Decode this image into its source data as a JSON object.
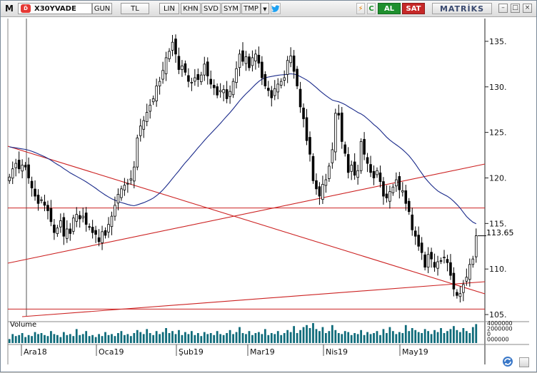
{
  "toolbar": {
    "logo": "M",
    "symbol_icon": "D̈",
    "symbol": "X30YVADE",
    "period": "GUN",
    "currency": "TL",
    "scale_buttons": [
      "LIN",
      "KHN",
      "SVD",
      "SYM",
      "TMP"
    ],
    "dropdown_icon": "▼",
    "twitter_icon": "twitter-bird",
    "flash_icon": "⚡",
    "refresh_icon": "C",
    "buy_label": "AL",
    "sell_label": "SAT",
    "brand": "MATRİKS",
    "window_buttons": [
      "–",
      "□",
      "×"
    ]
  },
  "chart": {
    "current_price_label": "113.65",
    "volume_label": "Volume",
    "volume_axis_labels": [
      "4000000",
      "2000000",
      "0",
      "000000"
    ]
  },
  "chart_data": {
    "type": "candlestick",
    "price_axis": {
      "ticks": [
        105,
        110,
        115,
        120,
        125,
        130,
        135
      ],
      "tick_labels": [
        "105.",
        "110.",
        "115.",
        "120.",
        "125.",
        "130.",
        "135."
      ],
      "range": [
        104.3,
        137.5
      ]
    },
    "time_axis_labels": [
      "Ara18",
      "Oca19",
      "Şub19",
      "Mar19",
      "Nis19",
      "May19"
    ],
    "current_price": 113.65,
    "horizontal_levels": [
      116.7,
      105.6
    ],
    "closes": [
      120.1,
      121.0,
      121.6,
      121.0,
      121.4,
      121.2,
      120.0,
      118.9,
      118.0,
      117.2,
      117.6,
      117.0,
      116.4,
      115.2,
      114.0,
      114.5,
      115.3,
      113.6,
      114.4,
      113.9,
      115.6,
      116.0,
      115.5,
      115.8,
      114.9,
      114.6,
      114.0,
      113.8,
      113.0,
      114.1,
      113.7,
      114.9,
      115.8,
      117.0,
      118.2,
      118.8,
      119.2,
      119.4,
      119.9,
      121.2,
      124.4,
      125.7,
      126.3,
      127.2,
      128.0,
      128.7,
      130.1,
      130.6,
      131.8,
      133.2,
      133.9,
      134.9,
      133.6,
      131.9,
      132.3,
      131.6,
      130.6,
      130.5,
      131.0,
      130.8,
      131.3,
      132.5,
      131.2,
      130.3,
      129.9,
      129.1,
      129.6,
      129.7,
      128.7,
      129.5,
      130.6,
      132.0,
      133.6,
      132.8,
      133.3,
      132.1,
      133.2,
      133.6,
      132.6,
      131.0,
      130.1,
      129.6,
      128.8,
      129.8,
      130.3,
      130.6,
      131.0,
      132.9,
      133.4,
      131.7,
      130.1,
      127.8,
      126.5,
      124.1,
      122.6,
      119.7,
      118.8,
      118.0,
      119.3,
      119.8,
      121.3,
      123.1,
      127.1,
      126.9,
      124.0,
      122.7,
      120.6,
      121.4,
      120.3,
      120.8,
      124.0,
      122.6,
      121.6,
      120.6,
      120.0,
      120.8,
      119.6,
      118.0,
      117.8,
      118.5,
      119.0,
      119.8,
      118.7,
      118.6,
      117.2,
      116.3,
      114.3,
      113.6,
      112.5,
      111.8,
      110.2,
      111.6,
      111.1,
      110.2,
      110.8,
      110.9,
      111.3,
      110.7,
      109.3,
      107.8,
      107.1,
      107.3,
      108.3,
      109.1,
      110.5,
      111.1,
      113.65
    ],
    "volumes": [
      0.4,
      0.9,
      0.7,
      0.8,
      1.0,
      0.6,
      0.8,
      0.7,
      1.1,
      0.9,
      1.0,
      0.8,
      0.7,
      1.2,
      0.9,
      0.8,
      0.6,
      1.1,
      0.8,
      0.9,
      0.7,
      1.4,
      0.8,
      0.9,
      1.2,
      0.7,
      0.8,
      0.6,
      0.9,
      0.7,
      1.1,
      0.8,
      0.9,
      0.7,
      1.0,
      1.2,
      0.8,
      0.9,
      0.7,
      1.0,
      1.3,
      1.1,
      0.9,
      1.4,
      1.0,
      0.8,
      1.2,
      0.9,
      1.1,
      1.5,
      1.0,
      1.2,
      0.9,
      1.3,
      0.8,
      1.1,
      0.9,
      1.2,
      0.8,
      1.0,
      0.7,
      1.1,
      0.9,
      1.0,
      0.8,
      1.2,
      0.9,
      0.8,
      1.0,
      1.3,
      0.9,
      1.1,
      1.6,
      1.0,
      0.9,
      1.2,
      0.8,
      1.0,
      1.1,
      0.9,
      1.4,
      0.8,
      1.0,
      0.9,
      1.2,
      0.8,
      1.0,
      1.3,
      1.1,
      1.7,
      1.0,
      1.3,
      1.6,
      1.8,
      1.5,
      2.0,
      1.4,
      1.2,
      1.6,
      1.0,
      1.2,
      1.8,
      1.3,
      1.0,
      0.9,
      1.2,
      1.1,
      0.8,
      1.0,
      0.9,
      1.3,
      0.8,
      1.1,
      0.9,
      1.0,
      1.2,
      0.8,
      1.4,
      1.0,
      1.6,
      1.2,
      0.9,
      1.1,
      1.0,
      1.8,
      1.2,
      1.5,
      1.3,
      1.1,
      1.0,
      1.4,
      1.2,
      0.9,
      1.3,
      1.1,
      1.5,
      1.0,
      1.2,
      1.4,
      1.7,
      1.3,
      1.1,
      1.5,
      1.2,
      1.0,
      1.6,
      1.9
    ]
  }
}
